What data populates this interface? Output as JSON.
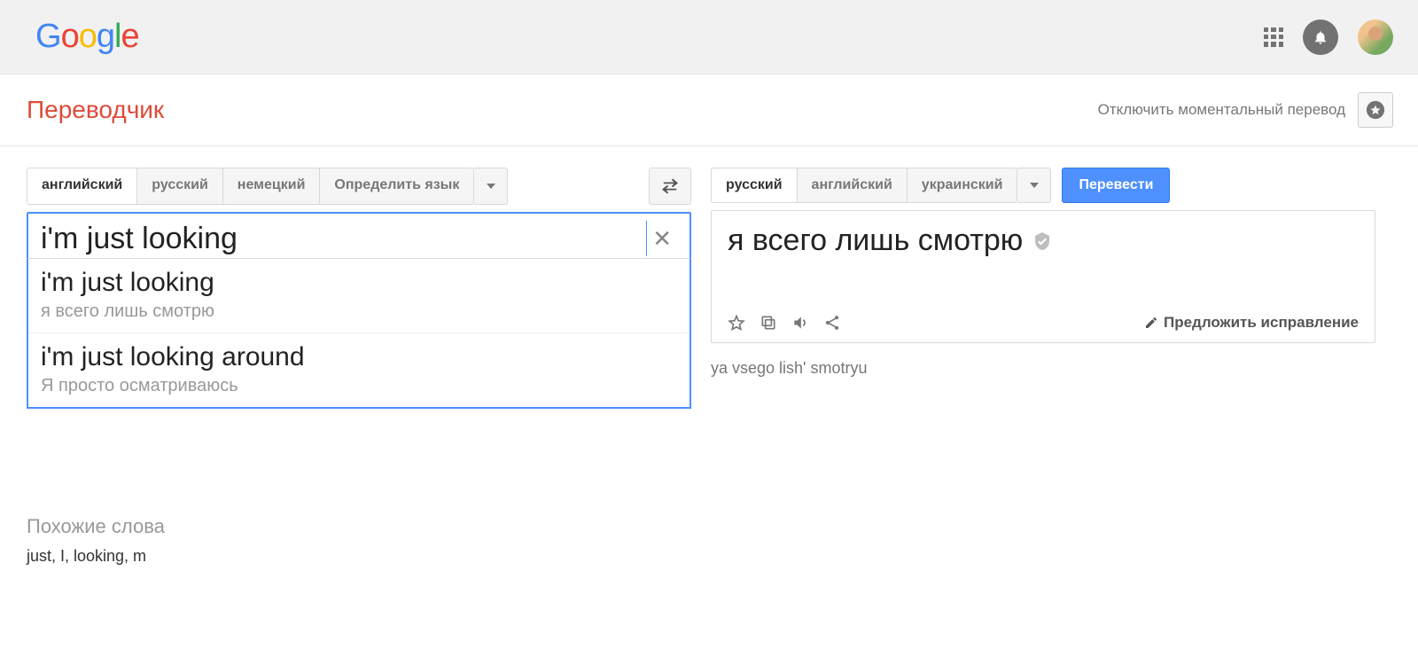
{
  "header": {
    "logo_letters": [
      "G",
      "o",
      "o",
      "g",
      "l",
      "e"
    ]
  },
  "subheader": {
    "app_title": "Переводчик",
    "instant_off": "Отключить моментальный перевод"
  },
  "source": {
    "langs": [
      "английский",
      "русский",
      "немецкий",
      "Определить язык"
    ],
    "active_index": 0,
    "input_text": "i'm just looking",
    "suggestions": [
      {
        "text": "i'm just looking",
        "translation": "я всего лишь смотрю"
      },
      {
        "text": "i'm just looking around",
        "translation": "Я просто осматриваюсь"
      }
    ]
  },
  "target": {
    "langs": [
      "русский",
      "английский",
      "украинский"
    ],
    "active_index": 0,
    "translate_btn": "Перевести",
    "text": "я всего лишь смотрю",
    "transliteration": "ya vsego lish' smotryu",
    "suggest_edit": "Предложить исправление"
  },
  "similar": {
    "title": "Похожие слова",
    "words": "just, I, looking, m"
  }
}
